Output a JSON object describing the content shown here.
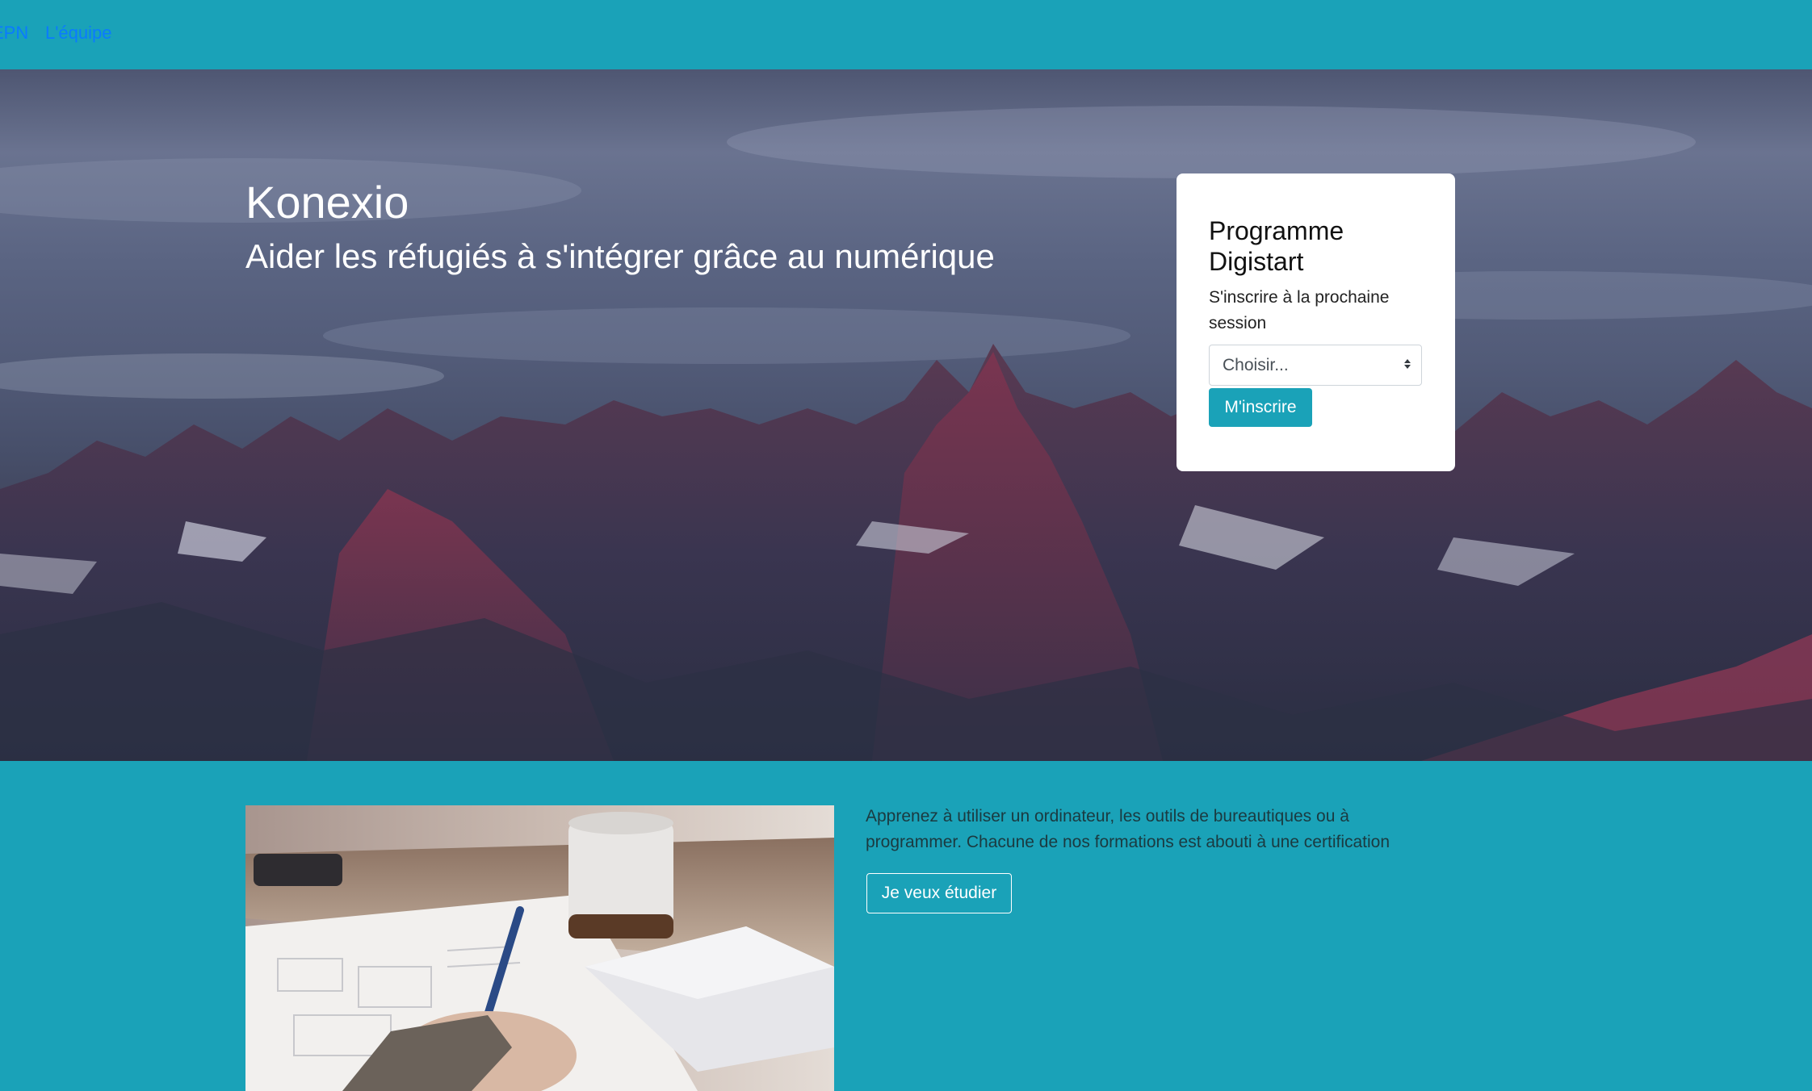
{
  "nav": {
    "items": [
      {
        "label": "EPN"
      },
      {
        "label": "L'équipe"
      }
    ]
  },
  "hero": {
    "title": "Konexio",
    "subtitle": "Aider les réfugiés à s'intégrer grâce au numérique"
  },
  "signup_card": {
    "title": "Programme Digistart",
    "text": "S'inscrire à la prochaine session",
    "select": {
      "selected": "Choisir..."
    },
    "button_label": "M'inscrire"
  },
  "study": {
    "description": "Apprenez à utiliser un ordinateur, les outils de bureautiques ou à programmer. Chacune de nos formations est abouti à une certification",
    "button_label": "Je veux étudier"
  },
  "colors": {
    "brand_teal": "#1aa2b8",
    "nav_link": "#0a7bff"
  }
}
